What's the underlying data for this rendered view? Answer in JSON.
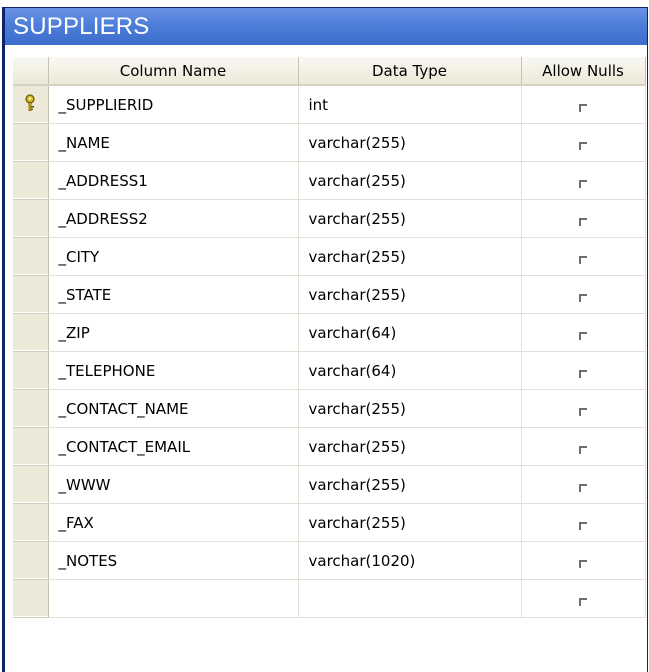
{
  "window": {
    "title": "SUPPLIERS"
  },
  "grid": {
    "columns": {
      "name": "Column Name",
      "type": "Data Type",
      "nulls": "Allow Nulls"
    },
    "rows": [
      {
        "name": "_SUPPLIERID",
        "type": "int",
        "allow_nulls": false,
        "primary_key": true
      },
      {
        "name": "_NAME",
        "type": "varchar(255)",
        "allow_nulls": false
      },
      {
        "name": "_ADDRESS1",
        "type": "varchar(255)",
        "allow_nulls": false
      },
      {
        "name": "_ADDRESS2",
        "type": "varchar(255)",
        "allow_nulls": false
      },
      {
        "name": "_CITY",
        "type": "varchar(255)",
        "allow_nulls": false
      },
      {
        "name": "_STATE",
        "type": "varchar(255)",
        "allow_nulls": false
      },
      {
        "name": "_ZIP",
        "type": "varchar(64)",
        "allow_nulls": false
      },
      {
        "name": "_TELEPHONE",
        "type": "varchar(64)",
        "allow_nulls": false
      },
      {
        "name": "_CONTACT_NAME",
        "type": "varchar(255)",
        "allow_nulls": false
      },
      {
        "name": "_CONTACT_EMAIL",
        "type": "varchar(255)",
        "allow_nulls": false
      },
      {
        "name": "_WWW",
        "type": "varchar(255)",
        "allow_nulls": false
      },
      {
        "name": "_FAX",
        "type": "varchar(255)",
        "allow_nulls": false
      },
      {
        "name": "_NOTES",
        "type": "varchar(1020)",
        "allow_nulls": false
      },
      {
        "name": "",
        "type": "",
        "allow_nulls": false
      }
    ]
  },
  "icons": {
    "primary_key": "key-icon",
    "checkbox": "checkbox-unchecked"
  },
  "colors": {
    "title_bar": "#4d7ed9",
    "window_border": "#0b246b",
    "header_bg": "#ece9d8"
  }
}
